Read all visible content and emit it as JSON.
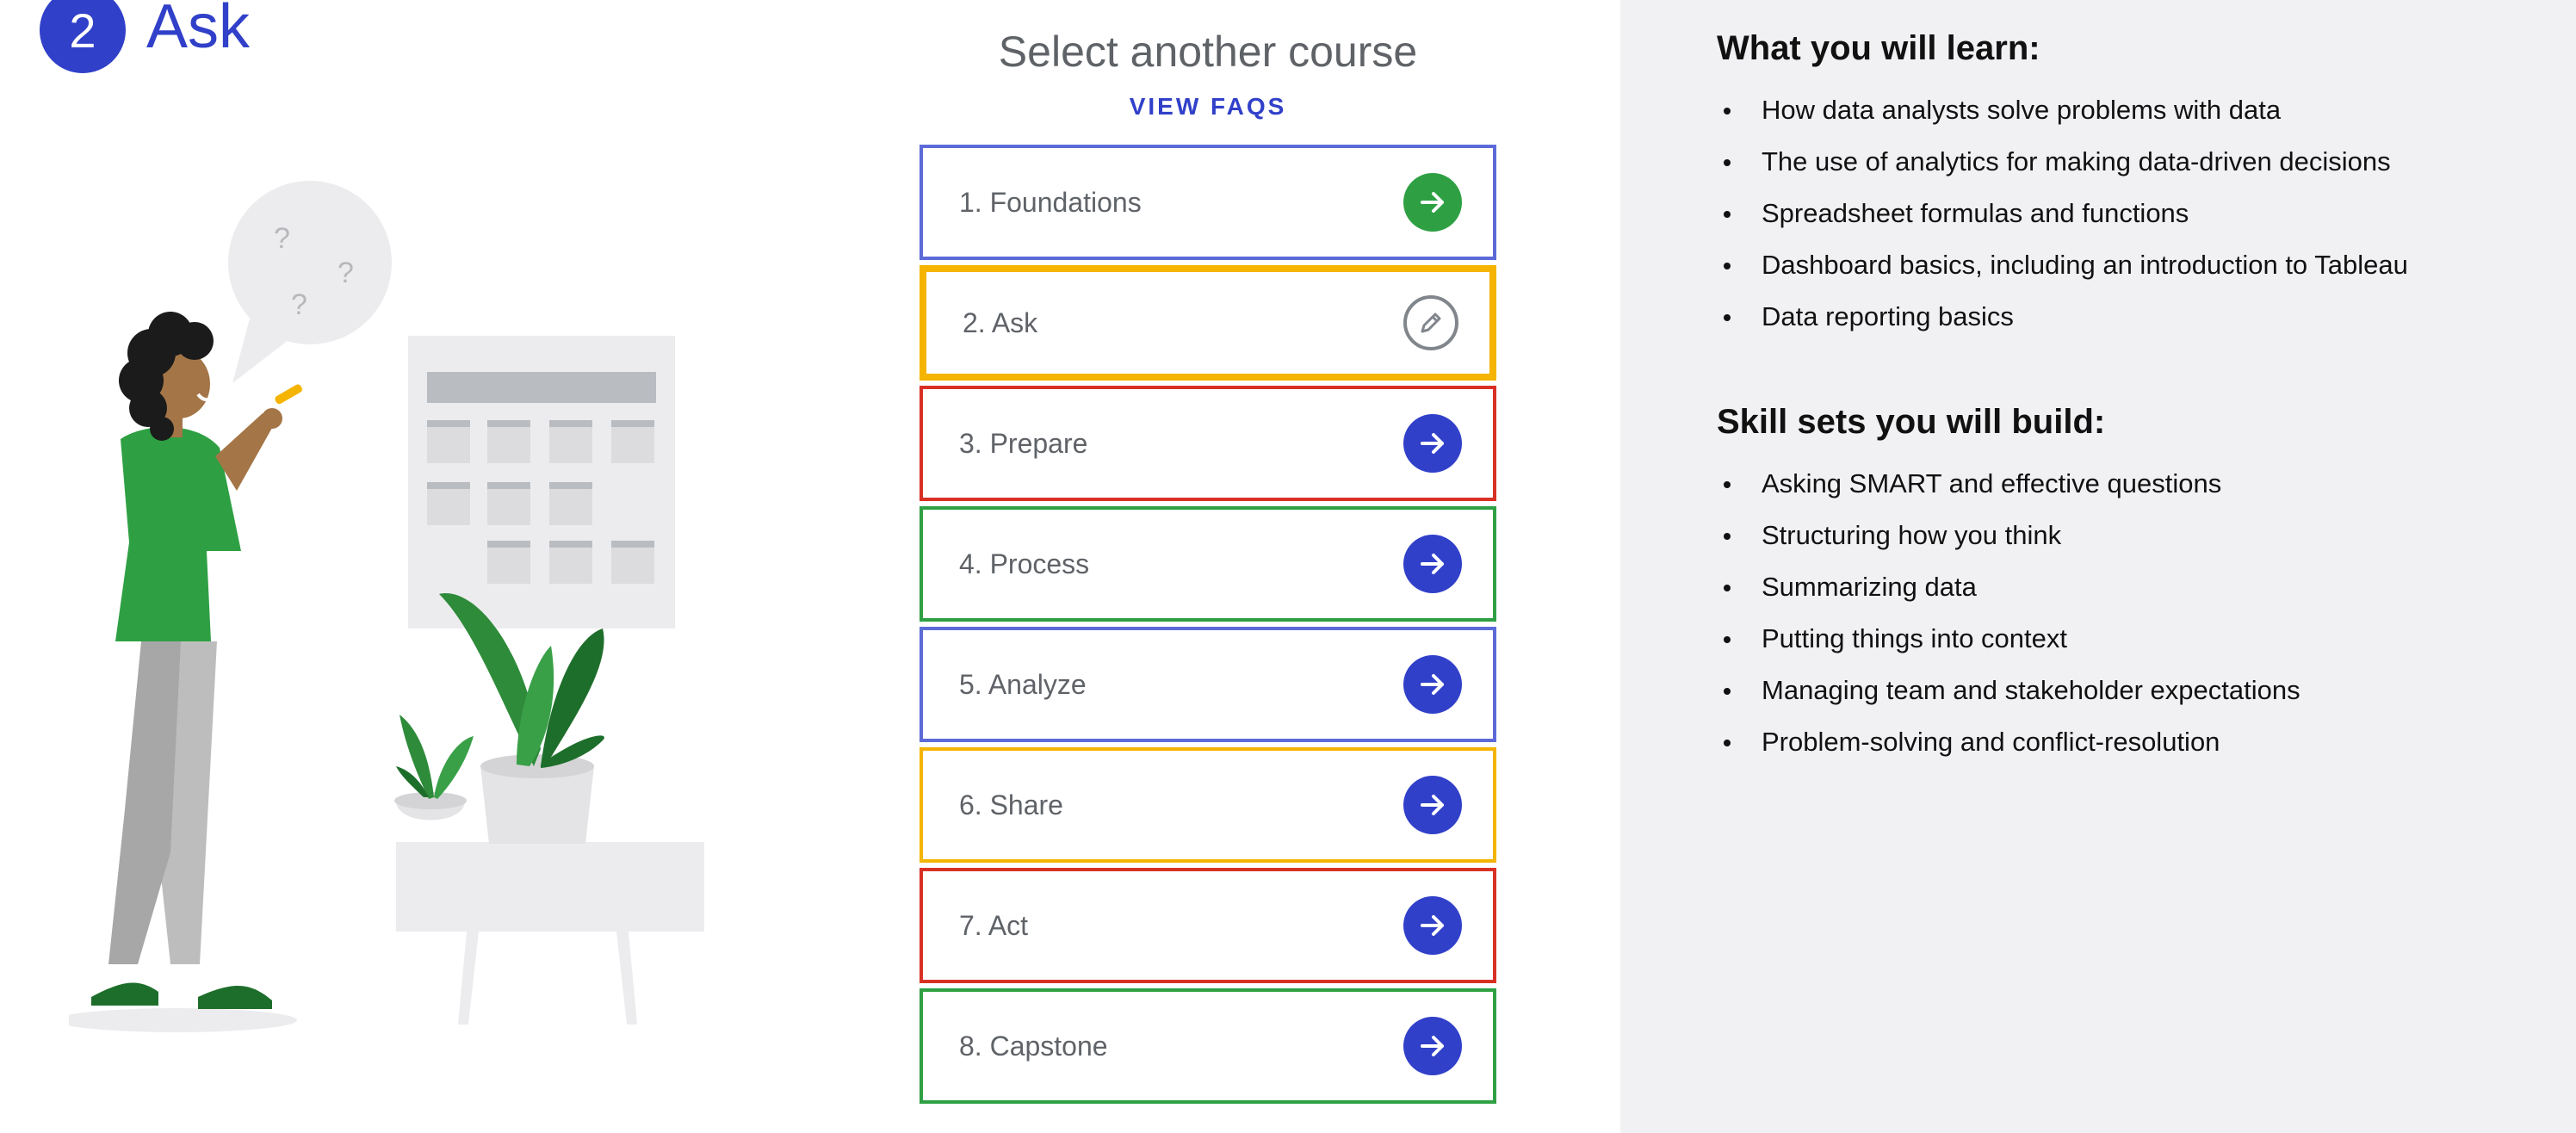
{
  "course": {
    "number": "2",
    "name": "Ask",
    "colors": {
      "brand_blue": "#3140c9",
      "active_border": "#f4b400"
    }
  },
  "illustration": {
    "question_marks": [
      "?",
      "?",
      "?"
    ]
  },
  "selector": {
    "title": "Select another course",
    "faq_link": "VIEW FAQS",
    "courses": [
      {
        "label": "1. Foundations",
        "border": "#5c6bd8",
        "icon": "arrow-right-icon",
        "icon_color": "#2ea043",
        "active": false
      },
      {
        "label": "2. Ask",
        "border": "#f4b400",
        "icon": "pencil-icon",
        "icon_color": "#80868b",
        "active": true
      },
      {
        "label": "3. Prepare",
        "border": "#d93025",
        "icon": "arrow-right-icon",
        "icon_color": "#3140c9",
        "active": false
      },
      {
        "label": "4. Process",
        "border": "#2ea043",
        "icon": "arrow-right-icon",
        "icon_color": "#3140c9",
        "active": false
      },
      {
        "label": "5. Analyze",
        "border": "#5c6bd8",
        "icon": "arrow-right-icon",
        "icon_color": "#3140c9",
        "active": false
      },
      {
        "label": "6. Share",
        "border": "#f4b400",
        "icon": "arrow-right-icon",
        "icon_color": "#3140c9",
        "active": false
      },
      {
        "label": "7. Act",
        "border": "#d93025",
        "icon": "arrow-right-icon",
        "icon_color": "#3140c9",
        "active": false
      },
      {
        "label": "8. Capstone",
        "border": "#2ea043",
        "icon": "arrow-right-icon",
        "icon_color": "#3140c9",
        "active": false
      }
    ]
  },
  "info": {
    "learn_heading": "What you will learn:",
    "learn_items": [
      "How data analysts solve problems with data",
      "The use of analytics for making data-driven decisions",
      "Spreadsheet formulas and functions",
      "Dashboard basics, including an introduction to Tableau",
      "Data reporting basics"
    ],
    "skills_heading": "Skill sets you will build:",
    "skills_items": [
      "Asking SMART and effective questions",
      "Structuring how you think",
      "Summarizing data",
      "Putting things into context",
      "Managing team and stakeholder expectations",
      "Problem-solving and conflict-resolution"
    ]
  }
}
